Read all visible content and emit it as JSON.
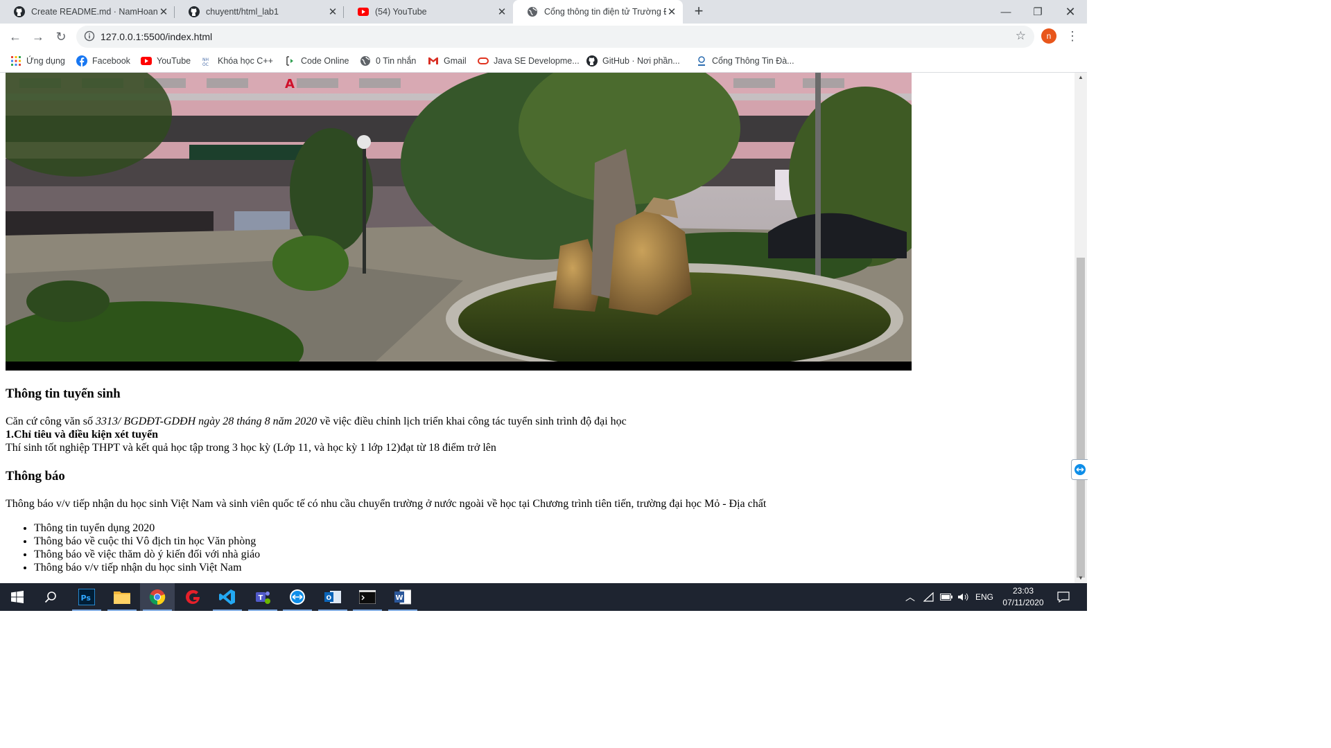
{
  "browser": {
    "tabs": [
      {
        "title": "Create README.md · NamHoang",
        "icon": "github-icon"
      },
      {
        "title": "chuyentt/html_lab1",
        "icon": "github-icon"
      },
      {
        "title": "(54) YouTube",
        "icon": "youtube-icon"
      },
      {
        "title": "Cổng thông tin điện tử Trường Đ",
        "icon": "globe-icon",
        "active": true
      }
    ],
    "url": "127.0.0.1:5500/index.html",
    "profile_initial": "n",
    "bookmarks": [
      {
        "label": "Ứng dụng",
        "icon": "apps-grid-icon"
      },
      {
        "label": "Facebook",
        "icon": "facebook-icon"
      },
      {
        "label": "YouTube",
        "icon": "youtube-icon"
      },
      {
        "label": "Khóa học C++",
        "icon": "course-icon"
      },
      {
        "label": "Code Online",
        "icon": "code-icon"
      },
      {
        "label": "0 Tin nhắn",
        "icon": "globe-icon"
      },
      {
        "label": "Gmail",
        "icon": "gmail-icon"
      },
      {
        "label": "Java SE Developme...",
        "icon": "oracle-icon"
      },
      {
        "label": "GitHub · Nơi phần...",
        "icon": "github-icon"
      },
      {
        "label": "Cổng Thông Tin Đà...",
        "icon": "portal-icon"
      }
    ]
  },
  "page": {
    "admissions": {
      "heading": "Thông tin tuyển sinh",
      "intro_prefix": "Căn cứ công văn số ",
      "intro_italic": "3313/ BGDĐT-GDĐH ngày 28 tháng 8 năm 2020",
      "intro_suffix": " về việc điều chỉnh lịch triển khai công tác tuyển sinh trình độ đại học",
      "criteria_heading": "1.Chỉ tiêu và điều kiện xét tuyển",
      "criteria_text": "Thí sinh tốt nghiệp THPT và kết quả học tập trong 3 học kỳ (Lớp 11, và học kỳ 1 lớp 12)đạt từ 18 điểm trở lên"
    },
    "notices": {
      "heading": "Thông báo",
      "text": "Thông báo v/v tiếp nhận du học sinh Việt Nam và sinh viên quốc tế có nhu cầu chuyển trường ở nước ngoài về học tại Chương trình tiên tiến, trường đại học Mỏ - Địa chất",
      "items": [
        "Thông tin tuyển dụng 2020",
        "Thông báo về cuộc thi Vô địch tin học Văn phòng",
        "Thông báo về việc thăm dò ý kiến đối với nhà giáo",
        "Thông báo v/v tiếp nhận du học sinh Việt Nam"
      ]
    }
  },
  "taskbar": {
    "apps": [
      "start-icon",
      "search-icon",
      "photoshop-icon",
      "file-explorer-icon",
      "chrome-icon",
      "garena-icon",
      "vscode-icon",
      "teams-icon",
      "teamviewer-icon",
      "outlook-icon",
      "terminal-icon",
      "word-icon"
    ],
    "language": "ENG",
    "time": "23:03",
    "date": "07/11/2020"
  }
}
